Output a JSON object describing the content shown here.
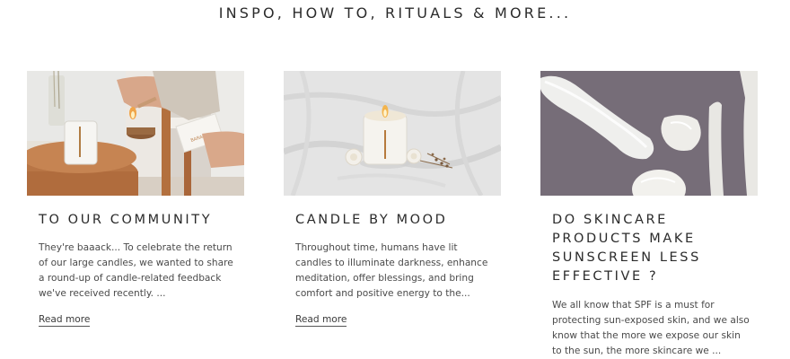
{
  "section": {
    "title": "INSPO, HOW TO, RITUALS & MORE..."
  },
  "cards": [
    {
      "title": "TO OUR COMMUNITY",
      "excerpt": "They're baaack... To celebrate the return of our large candles, we wanted to share a round-up of candle-related feedback we've received recently. ...",
      "read_more": "Read more"
    },
    {
      "title": "CANDLE BY MOOD",
      "excerpt": "Throughout time, humans have lit candles to illuminate darkness, enhance meditation, offer blessings, and bring comfort and positive energy to the...",
      "read_more": "Read more"
    },
    {
      "title": "DO SKINCARE\nPRODUCTS MAKE\nSUNSCREEN LESS\nEFFECTIVE ?",
      "excerpt": "We all know that SPF is a must for protecting sun-exposed skin, and we also know that the more we expose our skin to the sun, the more skincare we ..."
    }
  ]
}
